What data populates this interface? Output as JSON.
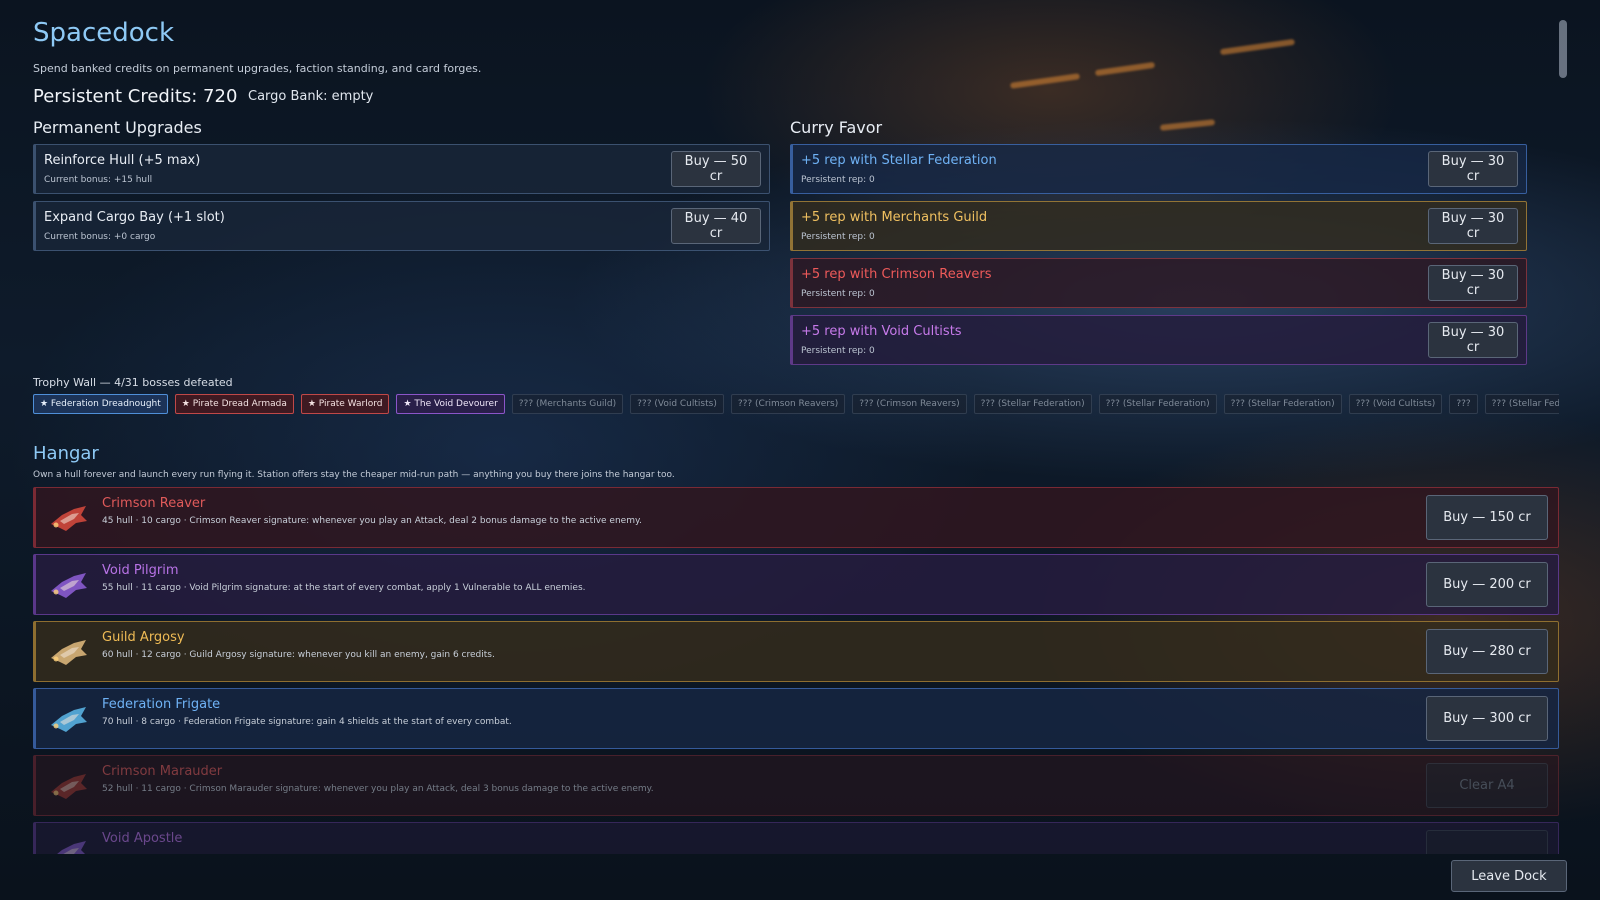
{
  "header": {
    "title": "Spacedock",
    "subtitle": "Spend banked credits on permanent upgrades, faction standing, and card forges.",
    "credits": "Persistent Credits: 720",
    "cargo_bank": "Cargo Bank: empty"
  },
  "upgrades": {
    "title": "Permanent Upgrades",
    "items": [
      {
        "name": "Reinforce Hull (+5 max)",
        "sub": "Current bonus: +15 hull",
        "button": "Buy — 50 cr"
      },
      {
        "name": "Expand Cargo Bay (+1 slot)",
        "sub": "Current bonus: +0 cargo",
        "button": "Buy — 40 cr"
      }
    ]
  },
  "favor": {
    "title": "Curry Favor",
    "items": [
      {
        "name": "+5 rep with Stellar Federation",
        "sub": "Persistent rep: 0",
        "button": "Buy — 30 cr",
        "color": "#6fb2f5"
      },
      {
        "name": "+5 rep with Merchants Guild",
        "sub": "Persistent rep: 0",
        "button": "Buy — 30 cr",
        "color": "#f0c060"
      },
      {
        "name": "+5 rep with Crimson Reavers",
        "sub": "Persistent rep: 0",
        "button": "Buy — 30 cr",
        "color": "#ee5a5a"
      },
      {
        "name": "+5 rep with Void Cultists",
        "sub": "Persistent rep: 0",
        "button": "Buy — 30 cr",
        "color": "#c77aea"
      }
    ]
  },
  "trophies": {
    "title": "Trophy Wall — 4/31 bosses defeated",
    "items": [
      {
        "label": "★ Federation Dreadnought",
        "state": "blue"
      },
      {
        "label": "★ Pirate Dread Armada",
        "state": "red"
      },
      {
        "label": "★ Pirate Warlord",
        "state": "red"
      },
      {
        "label": "★ The Void Devourer",
        "state": "purple"
      },
      {
        "label": "??? (Merchants Guild)",
        "state": "locked"
      },
      {
        "label": "??? (Void Cultists)",
        "state": "locked"
      },
      {
        "label": "??? (Crimson Reavers)",
        "state": "locked"
      },
      {
        "label": "??? (Crimson Reavers)",
        "state": "locked"
      },
      {
        "label": "??? (Stellar Federation)",
        "state": "locked"
      },
      {
        "label": "??? (Stellar Federation)",
        "state": "locked"
      },
      {
        "label": "??? (Stellar Federation)",
        "state": "locked"
      },
      {
        "label": "??? (Void Cultists)",
        "state": "locked"
      },
      {
        "label": "???",
        "state": "locked"
      },
      {
        "label": "??? (Stellar Federation)",
        "state": "locked"
      }
    ]
  },
  "hangar": {
    "title": "Hangar",
    "subtitle": "Own a hull forever and launch every run flying it. Station offers stay the cheaper mid-run path — anything you buy there joins the hangar too.",
    "ships": [
      {
        "name": "Crimson Reaver",
        "desc": "45 hull · 10 cargo · Crimson Reaver signature: whenever you play an Attack, deal 2 bonus damage to the active enemy.",
        "button": "Buy — 150 cr",
        "faction": "red",
        "accent": "#d0483c"
      },
      {
        "name": "Void Pilgrim",
        "desc": "55 hull · 11 cargo · Void Pilgrim signature: at the start of every combat, apply 1 Vulnerable to ALL enemies.",
        "button": "Buy — 200 cr",
        "faction": "purple",
        "accent": "#8a5cd0"
      },
      {
        "name": "Guild Argosy",
        "desc": "60 hull · 12 cargo · Guild Argosy signature: whenever you kill an enemy, gain 6 credits.",
        "button": "Buy — 280 cr",
        "faction": "gold",
        "accent": "#d9b47a"
      },
      {
        "name": "Federation Frigate",
        "desc": "70 hull · 8 cargo · Federation Frigate signature: gain 4 shields at the start of every combat.",
        "button": "Buy — 300 cr",
        "faction": "blue",
        "accent": "#58b0e0"
      },
      {
        "name": "Crimson Marauder",
        "desc": "52 hull · 11 cargo · Crimson Marauder signature: whenever you play an Attack, deal 3 bonus damage to the active enemy.",
        "button": "Clear A4",
        "faction": "red",
        "accent": "#a83a32",
        "locked": true
      },
      {
        "name": "Void Apostle",
        "desc": "",
        "button": "",
        "faction": "purple",
        "accent": "#8a5cd0",
        "locked": true
      }
    ]
  },
  "footer": {
    "leave_button": "Leave Dock"
  }
}
